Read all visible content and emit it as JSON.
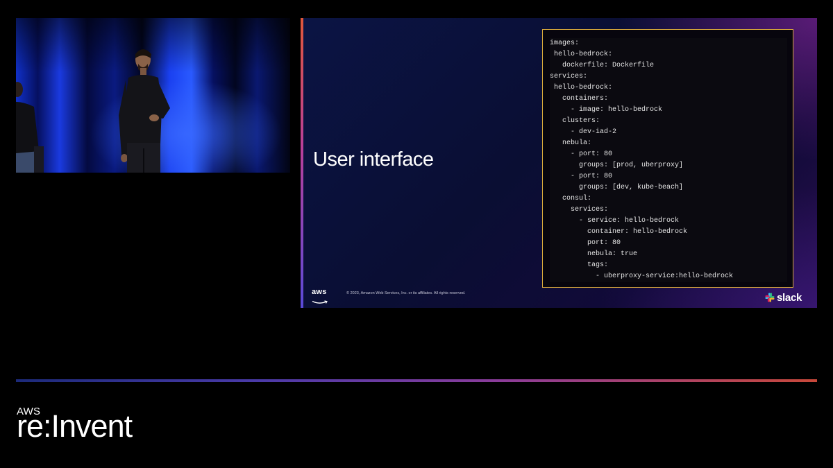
{
  "slide": {
    "title": "User interface",
    "copyright": "© 2023, Amazon Web Services, Inc. or its affiliates. All rights reserved.",
    "aws_logo_text": "aws",
    "slack_logo_text": "slack",
    "code_lines": [
      "images:",
      " hello-bedrock:",
      "   dockerfile: Dockerfile",
      "services:",
      " hello-bedrock:",
      "   containers:",
      "     - image: hello-bedrock",
      "   clusters:",
      "     - dev-iad-2",
      "   nebula:",
      "     - port: 80",
      "       groups: [prod, uberproxy]",
      "     - port: 80",
      "       groups: [dev, kube-beach]",
      "   consul:",
      "     services:",
      "       - service: hello-bedrock",
      "         container: hello-bedrock",
      "         port: 80",
      "         nebula: true",
      "         tags:",
      "           - uberproxy-service:hello-bedrock"
    ]
  },
  "branding": {
    "event_prefix": "AWS",
    "event_name": "re:Invent"
  },
  "colors": {
    "code_border": "#d8a93c",
    "accent_orange": "#e0573b",
    "accent_purple": "#5a4ad8"
  },
  "icons": {
    "aws": "aws-logo-icon",
    "slack": "slack-logo-icon",
    "event": "reinvent-logo-icon"
  }
}
